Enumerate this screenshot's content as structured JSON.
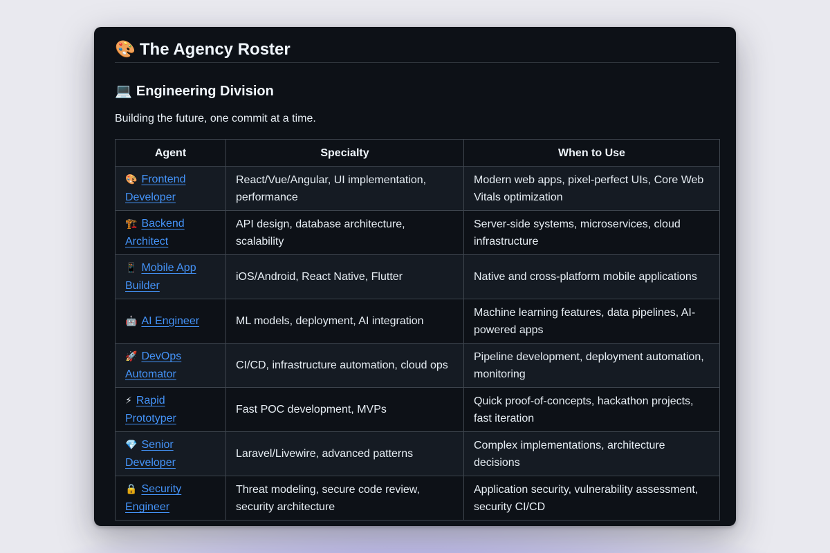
{
  "page": {
    "title_emoji": "🎨",
    "title": "The Agency Roster",
    "section_emoji": "💻",
    "section_title": "Engineering Division",
    "section_description": "Building the future, one commit at a time."
  },
  "table": {
    "headers": [
      "Agent",
      "Specialty",
      "When to Use"
    ],
    "rows": [
      {
        "emoji": "🎨",
        "icon_name": "palette-icon",
        "agent": "Frontend Developer",
        "specialty": "React/Vue/Angular, UI implementation, performance",
        "when": "Modern web apps, pixel-perfect UIs, Core Web Vitals optimization"
      },
      {
        "emoji": "🏗️",
        "icon_name": "construction-crane-icon",
        "agent": "Backend Architect",
        "specialty": "API design, database architecture, scalability",
        "when": "Server-side systems, microservices, cloud infrastructure"
      },
      {
        "emoji": "📱",
        "icon_name": "mobile-phone-icon",
        "agent": "Mobile App Builder",
        "specialty": "iOS/Android, React Native, Flutter",
        "when": "Native and cross-platform mobile applications"
      },
      {
        "emoji": "🤖",
        "icon_name": "robot-icon",
        "agent": "AI Engineer",
        "specialty": "ML models, deployment, AI integration",
        "when": "Machine learning features, data pipelines, AI-powered apps"
      },
      {
        "emoji": "🚀",
        "icon_name": "rocket-icon",
        "agent": "DevOps Automator",
        "specialty": "CI/CD, infrastructure automation, cloud ops",
        "when": "Pipeline development, deployment automation, monitoring"
      },
      {
        "emoji": "⚡",
        "icon_name": "lightning-icon",
        "agent": "Rapid Prototyper",
        "specialty": "Fast POC development, MVPs",
        "when": "Quick proof-of-concepts, hackathon projects, fast iteration"
      },
      {
        "emoji": "💎",
        "icon_name": "gem-icon",
        "agent": "Senior Developer",
        "specialty": "Laravel/Livewire, advanced patterns",
        "when": "Complex implementations, architecture decisions"
      },
      {
        "emoji": "🔒",
        "icon_name": "lock-icon",
        "agent": "Security Engineer",
        "specialty": "Threat modeling, secure code review, security architecture",
        "when": "Application security, vulnerability assessment, security CI/CD"
      }
    ]
  },
  "colors": {
    "window_bg": "#0d1117",
    "row_alt_bg": "#151b23",
    "border": "#3d444d",
    "link": "#4493f8",
    "text": "#e6edf3",
    "backdrop_glow": "#5b51d8"
  }
}
